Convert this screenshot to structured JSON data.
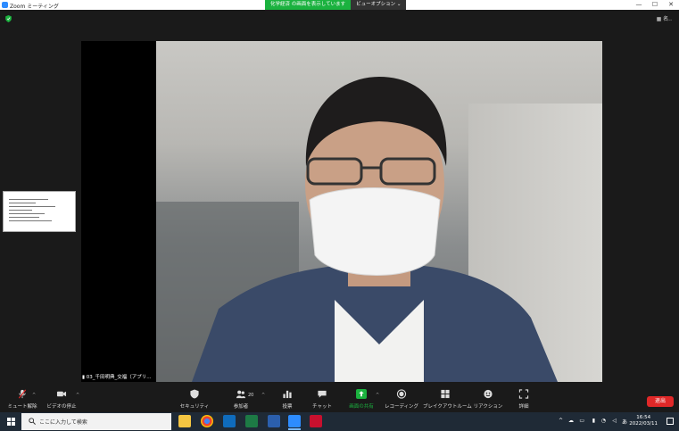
{
  "window": {
    "title": "Zoom ミーティング",
    "minimize_icon": "minimize-icon",
    "maximize_icon": "maximize-icon",
    "close_icon": "close-icon"
  },
  "share_banner": {
    "message": "化学経済 の画面を表示しています",
    "view_option_label": "ビューオプション ⌄"
  },
  "meeting": {
    "gallery_label": "名..",
    "participant_name": "03_千田明典_交福（アプリ..."
  },
  "toolbar": {
    "mute_label": "ミュート解除",
    "video_label": "ビデオの停止",
    "security_label": "セキュリティ",
    "participants_label": "参加者",
    "participants_count": "20",
    "polls_label": "投票",
    "chat_label": "チャット",
    "share_label": "画面の共有",
    "record_label": "レコーディング",
    "breakout_label": "ブレイクアウトルーム",
    "reactions_label": "リアクション",
    "more_label": "詳細",
    "leave_label": "退出",
    "accent_green": "#1bb23f",
    "leave_red": "#e02828"
  },
  "taskbar": {
    "search_placeholder": "ここに入力して検索",
    "apps": [
      "file-explorer-icon",
      "chrome-icon",
      "outlook-icon",
      "excel-icon",
      "word-icon",
      "zoom-icon",
      "acrobat-icon"
    ],
    "ime": "あ",
    "time": "16:54",
    "date": "2022/03/11"
  }
}
